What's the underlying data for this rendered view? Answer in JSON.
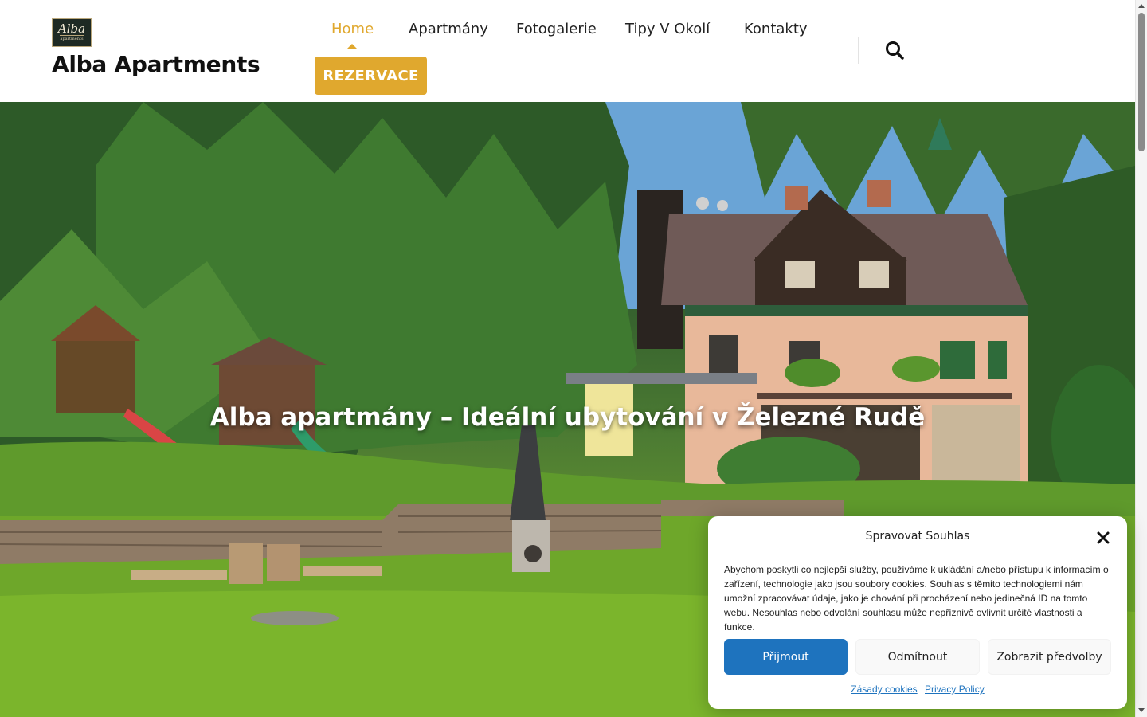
{
  "site": {
    "logo_text": "Alba",
    "logo_subtext": "apartments",
    "title": "Alba Apartments"
  },
  "nav": {
    "items": [
      {
        "label": "Home",
        "active": true
      },
      {
        "label": "Apartmány",
        "active": false
      },
      {
        "label": "Fotogalerie",
        "active": false
      },
      {
        "label": "Tipy V Okolí",
        "active": false
      },
      {
        "label": "Kontakty",
        "active": false
      }
    ],
    "cta_label": "REZERVACE",
    "search_icon": "search-icon"
  },
  "hero": {
    "title": "Alba apartmány – Ideální ubytování v Železné Rudě"
  },
  "cookie": {
    "title": "Spravovat Souhlas",
    "close_icon": "close-icon",
    "text": "Abychom poskytli co nejlepší služby, používáme k ukládání a/nebo přístupu k informacím o zařízení, technologie jako jsou soubory cookies. Souhlas s těmito technologiemi nám umožní zpracovávat údaje, jako je chování při procházení nebo jedinečná ID na tomto webu. Nesouhlas nebo odvolání souhlasu může nepříznivě ovlivnit určité vlastnosti a funkce.",
    "accept_label": "Přijmout",
    "deny_label": "Odmítnout",
    "prefs_label": "Zobrazit předvolby",
    "link_cookies": "Zásady cookies",
    "link_privacy": "Privacy Policy"
  },
  "colors": {
    "accent": "#e0a82e",
    "primary_button": "#1e73be",
    "text": "#222222"
  }
}
